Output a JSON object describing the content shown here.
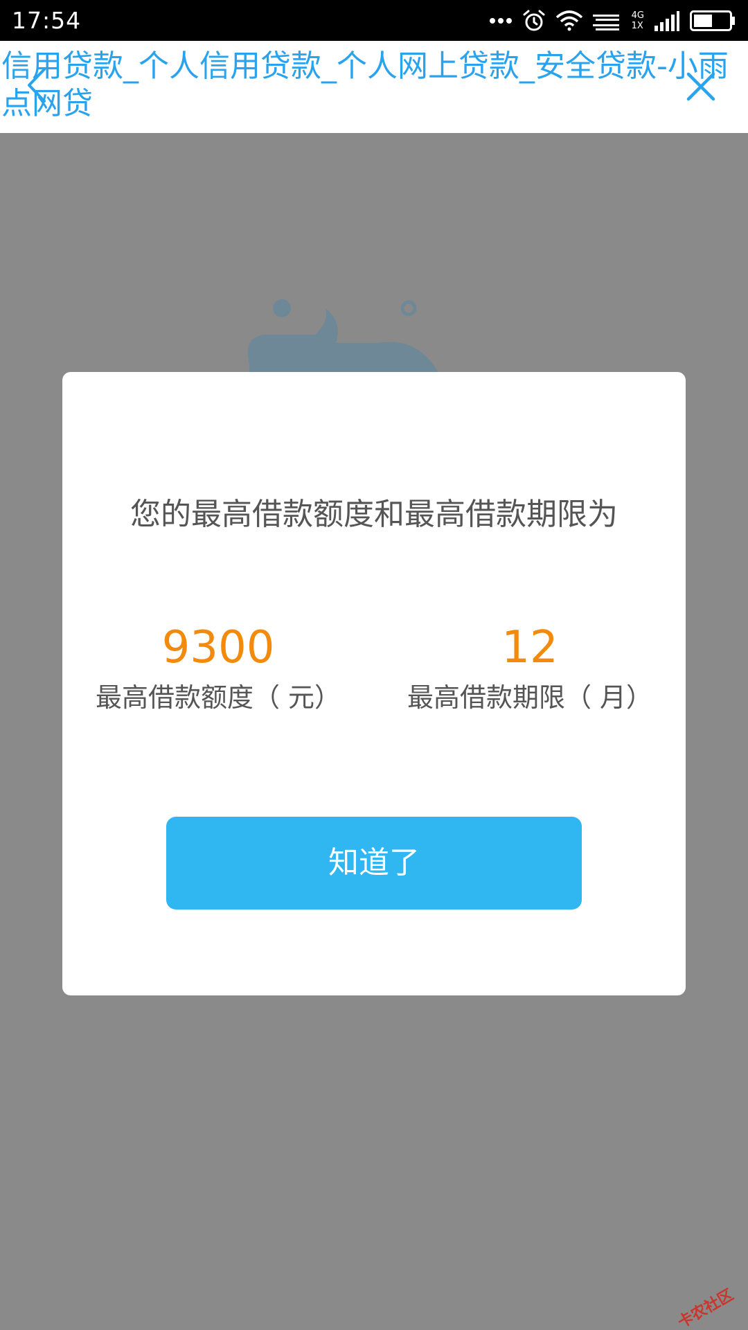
{
  "status_bar": {
    "time": "17:54",
    "network_top": "4G",
    "network_bottom": "1X",
    "icons": [
      "more-dots-icon",
      "alarm-icon",
      "wifi-icon",
      "signal-icon",
      "battery-icon"
    ]
  },
  "title_bar": {
    "title": "信用贷款_个人信用贷款_个人网上贷款_安全贷款-小雨点网贷",
    "icons": [
      "back-icon",
      "close-icon"
    ]
  },
  "dialog": {
    "heading": "您的最高借款额度和最高借款期限为",
    "amount": {
      "value": "9300",
      "label": "最高借款额度（ 元）"
    },
    "term": {
      "value": "12",
      "label": "最高借款期限（ 月）"
    },
    "confirm_label": "知道了"
  },
  "watermark": "卡农社区",
  "colors": {
    "accent": "#30b6f1",
    "title": "#29a3ee",
    "highlight": "#f28b0c",
    "overlay": "#8a8a8a"
  }
}
